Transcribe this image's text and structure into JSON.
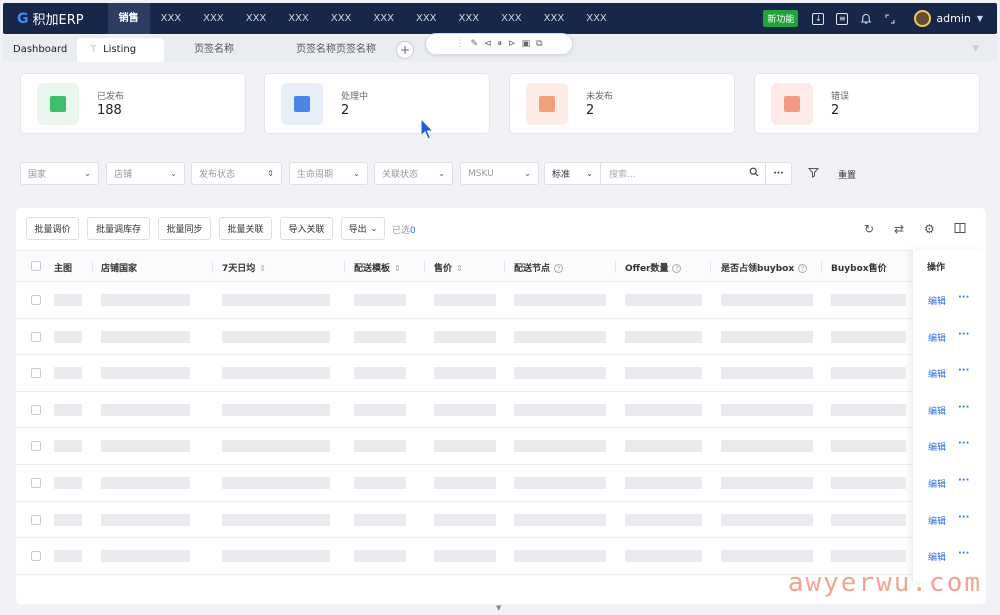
{
  "app": {
    "logo_mark": "G",
    "logo_text": "积加ERP"
  },
  "nav": {
    "items": [
      "销售",
      "XXX",
      "XXX",
      "XXX",
      "XXX",
      "XXX",
      "XXX",
      "XXX",
      "XXX",
      "XXX",
      "XXX",
      "XXX"
    ],
    "new_badge": "新功能",
    "user": "admin"
  },
  "tabs": {
    "items": [
      "Dashboard",
      "Listing",
      "页签名称",
      "页签名称页签名称"
    ],
    "active_index": 1
  },
  "stats": [
    {
      "label": "已发布",
      "value": "188",
      "color": "#3fbf6b",
      "bg": "#e9f7ee",
      "icon": "check-doc-icon"
    },
    {
      "label": "处理中",
      "value": "2",
      "color": "#4a86e8",
      "bg": "#e8eef9",
      "icon": "refresh-doc-icon"
    },
    {
      "label": "未发布",
      "value": "2",
      "color": "#f0a07a",
      "bg": "#fdece4",
      "icon": "yen-doc-icon"
    },
    {
      "label": "错误",
      "value": "2",
      "color": "#f29a86",
      "bg": "#fde9e5",
      "icon": "error-doc-icon"
    }
  ],
  "filters": {
    "country": "国家",
    "store": "店铺",
    "publish_status": "发布状态",
    "lifecycle": "生命周期",
    "link_status": "关联状态",
    "msku": "MSKU",
    "search_mode": "标准",
    "search_placeholder": "搜索...",
    "reset": "重置"
  },
  "toolbar": {
    "buttons": [
      "批量调价",
      "批量调库存",
      "批量同步",
      "批量关联",
      "导入关联",
      "导出"
    ],
    "selected_prefix": "已选",
    "selected_count": "0"
  },
  "table": {
    "columns": [
      "主图",
      "店铺国家",
      "7天日均",
      "配送模板",
      "售价",
      "配送节点",
      "Offer数量",
      "是否占领buybox",
      "Buybox售价"
    ],
    "op_header": "操作",
    "row_count": 8,
    "edit_label": "编辑",
    "more_label": "···"
  },
  "watermark": "awyerwu.com"
}
